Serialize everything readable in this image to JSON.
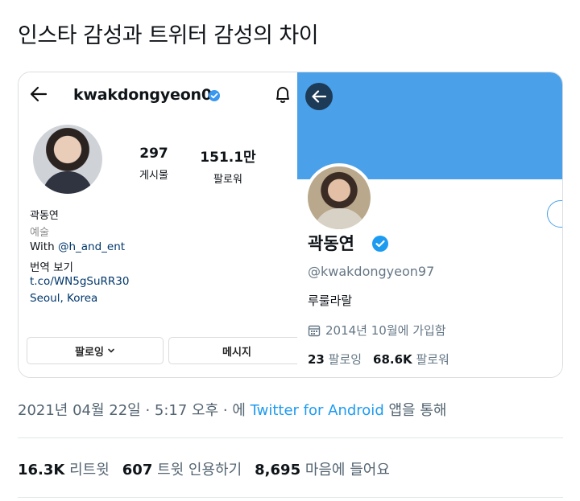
{
  "tweet": {
    "text": "인스타 감성과 트위터 감성의 차이",
    "date": "2021년 04월 22일 · 5:17 오후 · 에 ",
    "source": "Twitter for Android",
    "source_suffix": " 앱을 통해",
    "retweets": "16.3K",
    "retweets_label": " 리트윗",
    "quotes": "607",
    "quotes_label": " 트윗 인용하기",
    "likes": "8,695",
    "likes_label": " 마음에 들어요"
  },
  "instagram": {
    "username": "kwakdongyeon0",
    "posts_count": "297",
    "posts_label": "게시물",
    "followers_count": "151.1만",
    "followers_label": "팔로워",
    "name": "곽동연",
    "category": "예술",
    "bio_prefix": "With ",
    "bio_mention": "@h_and_ent",
    "translate": "번역 보기",
    "link": "t.co/WN5gSuRR30",
    "location": "Seoul, Korea",
    "following_button": "팔로잉",
    "message_button": "메시지"
  },
  "twitter": {
    "name": "곽동연",
    "handle": "@kwakdongyeon97",
    "bio": "루룰라랄",
    "joined": "2014년 10월에 가입함",
    "following_count": "23",
    "following_label": " 팔로잉",
    "followers_count": "68.6K",
    "followers_label": " 팔로워"
  },
  "colors": {
    "twitter_blue": "#1d9bf0",
    "banner_blue": "#4aa1e9",
    "instagram_verified": "#3897f0",
    "link_blue": "#00376b"
  }
}
